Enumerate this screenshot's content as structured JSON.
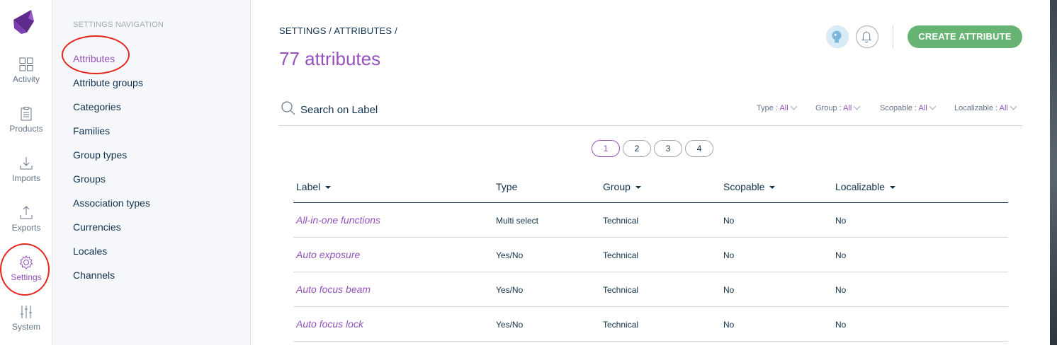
{
  "menu": {
    "items": [
      {
        "label": "Activity",
        "icon": "dashboard-icon"
      },
      {
        "label": "Products",
        "icon": "clipboard-icon"
      },
      {
        "label": "Imports",
        "icon": "import-icon"
      },
      {
        "label": "Exports",
        "icon": "export-icon"
      },
      {
        "label": "Settings",
        "icon": "gear-icon"
      },
      {
        "label": "System",
        "icon": "sliders-icon"
      }
    ],
    "active": "Settings"
  },
  "subnav": {
    "title": "SETTINGS NAVIGATION",
    "items": [
      {
        "label": "Attributes"
      },
      {
        "label": "Attribute groups"
      },
      {
        "label": "Categories"
      },
      {
        "label": "Families"
      },
      {
        "label": "Group types"
      },
      {
        "label": "Groups"
      },
      {
        "label": "Association types"
      },
      {
        "label": "Currencies"
      },
      {
        "label": "Locales"
      },
      {
        "label": "Channels"
      }
    ],
    "active": "Attributes"
  },
  "header": {
    "breadcrumb": "SETTINGS / ATTRIBUTES /",
    "title": "77 attributes",
    "create_label": "CREATE ATTRIBUTE"
  },
  "search": {
    "placeholder": "Search on Label"
  },
  "filters": [
    {
      "label": "Type :",
      "value": "All"
    },
    {
      "label": "Group :",
      "value": "All"
    },
    {
      "label": "Scopable :",
      "value": "All"
    },
    {
      "label": "Localizable :",
      "value": "All"
    }
  ],
  "pagination": {
    "pages": [
      "1",
      "2",
      "3",
      "4"
    ],
    "current": "1"
  },
  "table": {
    "columns": [
      {
        "label": "Label",
        "sortable": true
      },
      {
        "label": "Type",
        "sortable": false
      },
      {
        "label": "Group",
        "sortable": true
      },
      {
        "label": "Scopable",
        "sortable": true
      },
      {
        "label": "Localizable",
        "sortable": true
      }
    ],
    "rows": [
      {
        "label": "All-in-one functions",
        "type": "Multi select",
        "group": "Technical",
        "scopable": "No",
        "localizable": "No"
      },
      {
        "label": "Auto exposure",
        "type": "Yes/No",
        "group": "Technical",
        "scopable": "No",
        "localizable": "No"
      },
      {
        "label": "Auto focus beam",
        "type": "Yes/No",
        "group": "Technical",
        "scopable": "No",
        "localizable": "No"
      },
      {
        "label": "Auto focus lock",
        "type": "Yes/No",
        "group": "Technical",
        "scopable": "No",
        "localizable": "No"
      }
    ]
  },
  "colors": {
    "accent": "#9452ba",
    "create_button": "#67b373",
    "text": "#11324d",
    "annotation": "#e3261d"
  }
}
